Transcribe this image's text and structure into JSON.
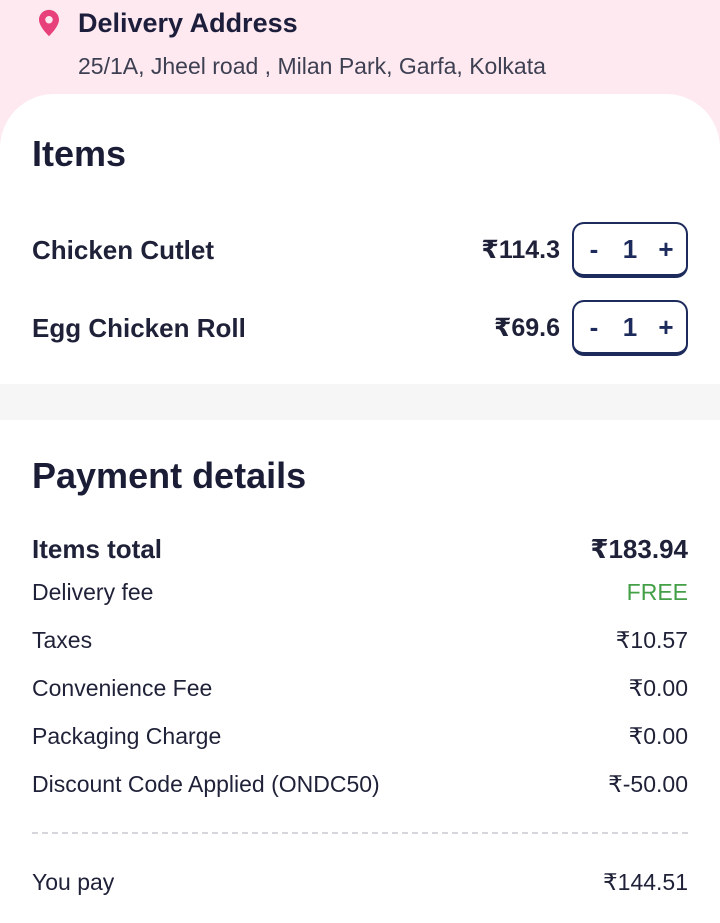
{
  "delivery": {
    "title": "Delivery Address",
    "address": "25/1A, Jheel road , Milan Park, Garfa, Kolkata",
    "icon": "location-pin-icon",
    "accent": "#e8407a"
  },
  "items": {
    "title": "Items",
    "list": [
      {
        "name": "Chicken Cutlet",
        "price": "₹114.3",
        "qty": "1",
        "minus": "-",
        "plus": "+"
      },
      {
        "name": "Egg Chicken Roll",
        "price": "₹69.6",
        "qty": "1",
        "minus": "-",
        "plus": "+"
      }
    ]
  },
  "payment": {
    "title": "Payment details",
    "rows": [
      {
        "label": "Items total",
        "value": "₹183.94"
      },
      {
        "label": "Delivery fee",
        "value": "FREE"
      },
      {
        "label": "Taxes",
        "value": "₹10.57"
      },
      {
        "label": "Convenience Fee",
        "value": "₹0.00"
      },
      {
        "label": "Packaging Charge",
        "value": "₹0.00"
      },
      {
        "label": "Discount Code Applied (ONDC50)",
        "value": "₹-50.00"
      }
    ],
    "total": {
      "label": "You pay",
      "value": "₹144.51"
    },
    "free_color": "#43a047"
  }
}
